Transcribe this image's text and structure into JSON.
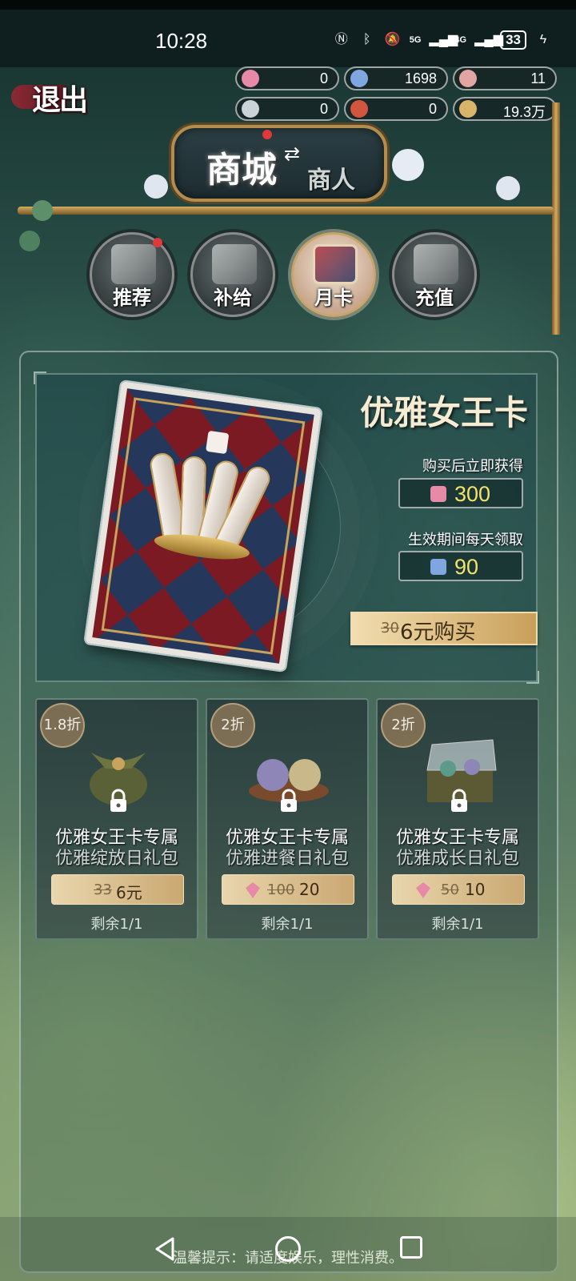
{
  "status_bar": {
    "time": "10:28",
    "battery": "33",
    "net1": "5G",
    "net2": "4G"
  },
  "header": {
    "back_label": "退出",
    "title_main": "商城",
    "title_sub": "商人"
  },
  "currencies": [
    {
      "name": "pink-gem",
      "value": "0",
      "color": "#e68aa8"
    },
    {
      "name": "blue-crystal",
      "value": "1698",
      "color": "#7fa6e0"
    },
    {
      "name": "pink-scroll",
      "value": "11",
      "color": "#e3a4a4"
    },
    {
      "name": "silver-button",
      "value": "0",
      "color": "#c9d3d8"
    },
    {
      "name": "red-star",
      "value": "0",
      "color": "#d2553f"
    },
    {
      "name": "gold-coins",
      "value": "19.3万",
      "color": "#d9b46a"
    }
  ],
  "tabs": [
    {
      "label": "推荐",
      "active": false,
      "dot": true
    },
    {
      "label": "补给",
      "active": false,
      "dot": false
    },
    {
      "label": "月卡",
      "active": true,
      "dot": false
    },
    {
      "label": "充值",
      "active": false,
      "dot": false
    }
  ],
  "monthly_card": {
    "title": "优雅女王卡",
    "instant_label": "购买后立即获得",
    "instant_value": "300",
    "daily_label": "生效期间每天领取",
    "daily_value": "90",
    "original_price": "30",
    "buy_label": "6元购买"
  },
  "packs": [
    {
      "discount": "1.8折",
      "name": "优雅女王卡专属",
      "sub": "优雅绽放日礼包",
      "old_price": "33",
      "price": "6元",
      "gem": false,
      "remaining": "剩余1/1"
    },
    {
      "discount": "2折",
      "name": "优雅女王卡专属",
      "sub": "优雅进餐日礼包",
      "old_price": "100",
      "price": "20",
      "gem": true,
      "remaining": "剩余1/1"
    },
    {
      "discount": "2折",
      "name": "优雅女王卡专属",
      "sub": "优雅成长日礼包",
      "old_price": "50",
      "price": "10",
      "gem": true,
      "remaining": "剩余1/1"
    }
  ],
  "footer": {
    "tip": "温馨提示：请适度娱乐，理性消费。"
  }
}
